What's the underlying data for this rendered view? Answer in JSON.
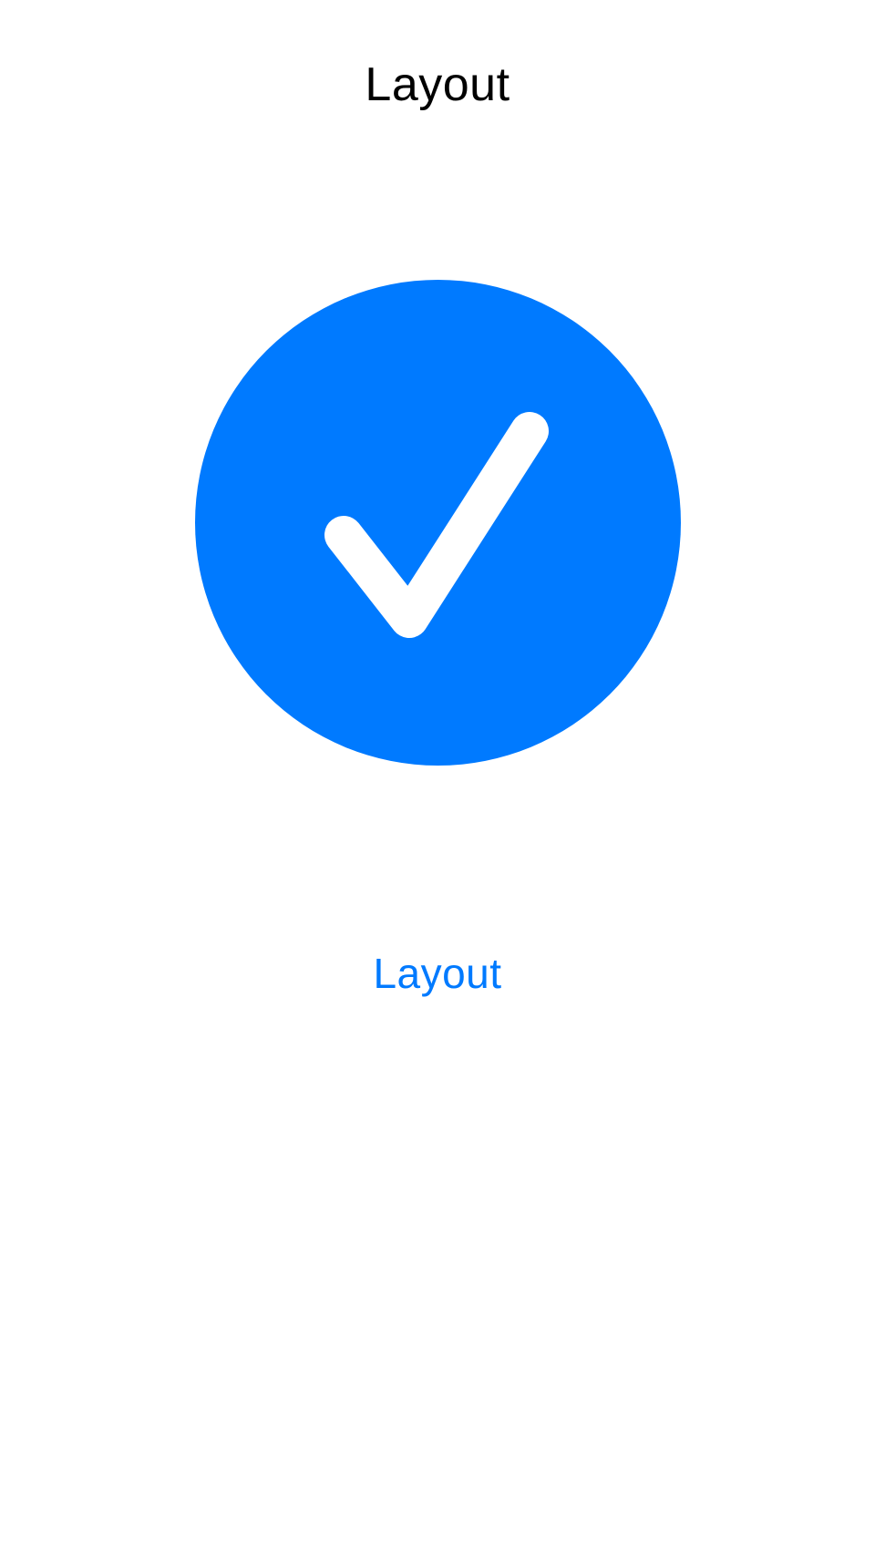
{
  "header": {
    "title": "Layout"
  },
  "main": {
    "status_icon": "checkmark-circle-icon",
    "link_label": "Layout"
  },
  "colors": {
    "accent": "#007AFF",
    "title": "#000000",
    "check": "#FFFFFF",
    "background": "#FFFFFF"
  }
}
